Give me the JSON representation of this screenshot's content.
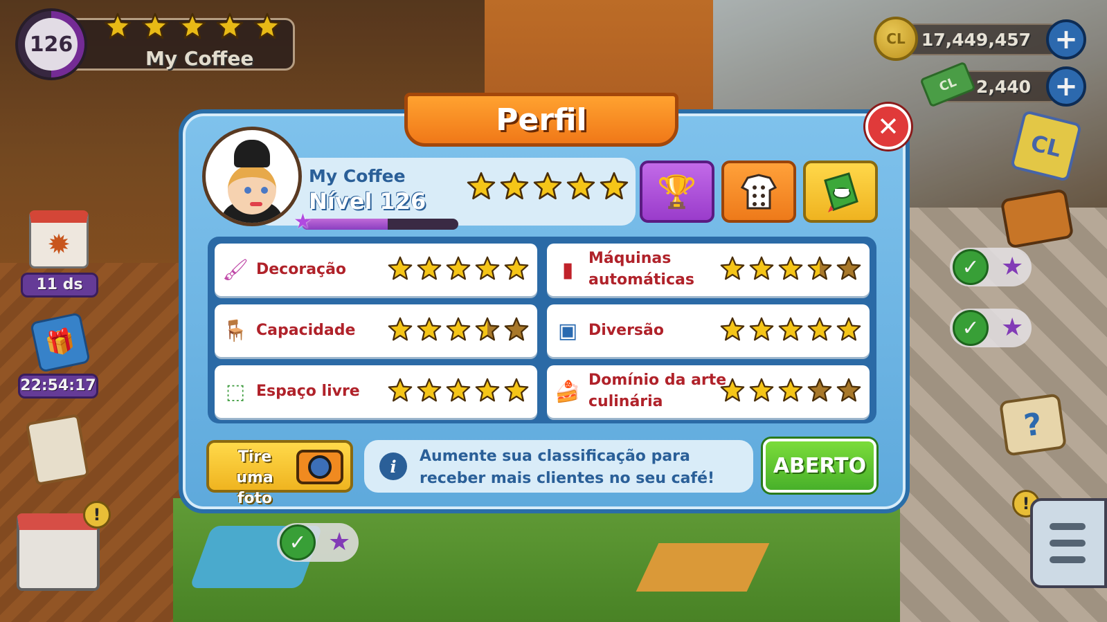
{
  "hud": {
    "level": "126",
    "cafe_name": "My Coffee",
    "stars": [
      1,
      1,
      1,
      1,
      1
    ],
    "coins": "17,449,457",
    "coin_icon_text": "CL",
    "cash": "2,440",
    "cash_icon_text": "CL",
    "plus_icon": "+"
  },
  "left_widgets": {
    "calendar_icon": "maple-leaf-icon",
    "calendar_timer": "11 ds",
    "gift_timer": "22:54:17",
    "exclaim": "!"
  },
  "right_widgets": {
    "cards_text": "CL",
    "help_text": "?",
    "exclaim": "!",
    "check": "✓",
    "star": "★"
  },
  "modal": {
    "title": "Perfil",
    "close": "✕",
    "profile": {
      "name": "My Coffee",
      "level_label": "Nível 126",
      "xp_fraction": 0.55,
      "stars": [
        1,
        1,
        1,
        1,
        0.85
      ]
    },
    "buttons": {
      "trophy_icon": "🏆",
      "chef_icon": "chef-jacket-icon",
      "book_icon": "recipe-book-icon"
    },
    "ratings": [
      {
        "label": "Decoração",
        "icon": "paint-roller-icon",
        "stars": [
          1,
          1,
          1,
          1,
          1
        ]
      },
      {
        "label": "Máquinas automáticas",
        "icon": "vending-machine-icon",
        "stars": [
          1,
          1,
          1,
          0.5,
          0
        ]
      },
      {
        "label": "Capacidade",
        "icon": "table-chairs-icon",
        "stars": [
          1,
          1,
          1,
          0.5,
          0
        ]
      },
      {
        "label": "Diversão",
        "icon": "tv-icon",
        "stars": [
          1,
          1,
          1,
          1,
          1
        ]
      },
      {
        "label": "Espaço livre",
        "icon": "open-space-icon",
        "stars": [
          1,
          1,
          1,
          1,
          1
        ]
      },
      {
        "label": "Domínio da arte culinária",
        "icon": "cake-icon",
        "stars": [
          1,
          1,
          1,
          0,
          0
        ]
      }
    ],
    "photo_button": "Tire uma foto",
    "info_text": "Aumente sua classificação para receber mais clientes no seu café!",
    "info_icon": "i",
    "open_button": "ABERTO"
  },
  "colors": {
    "star_gold": "#f5c518",
    "star_dim": "#a8782a",
    "label_red": "#b0222a",
    "info_blue": "#2a5f98"
  }
}
